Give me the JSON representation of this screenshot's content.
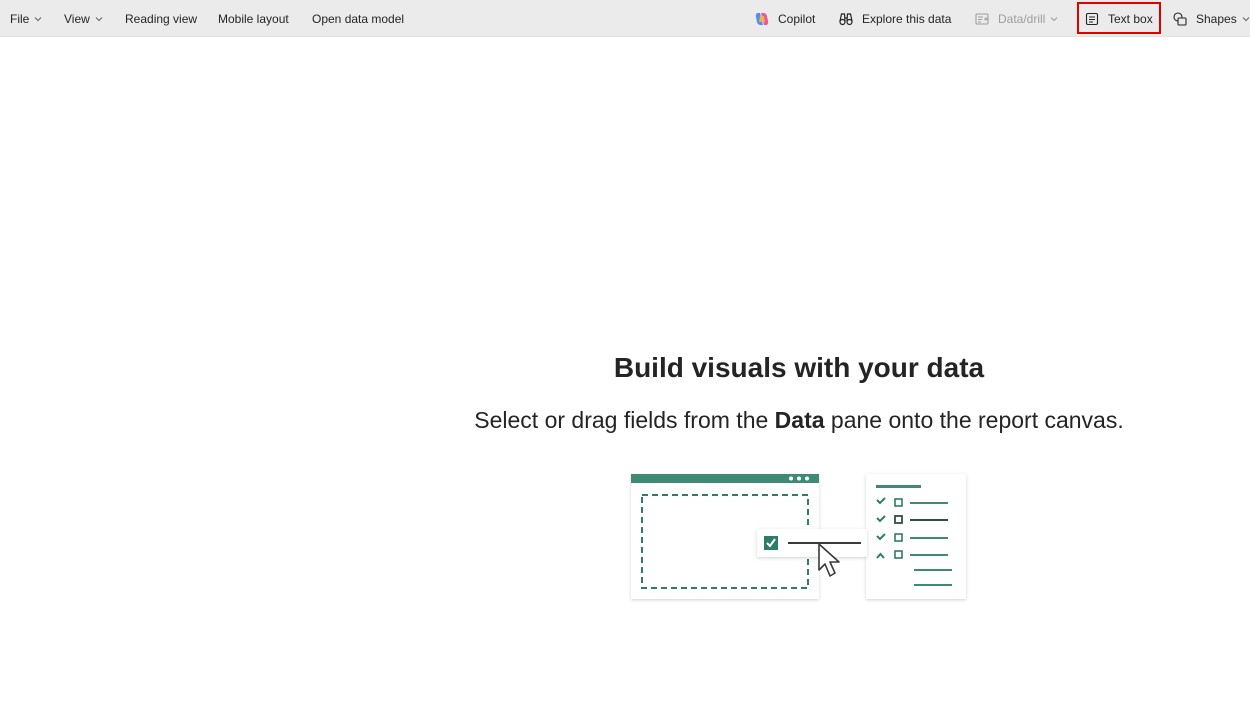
{
  "toolbar": {
    "file": "File",
    "view": "View",
    "reading_view": "Reading view",
    "mobile_layout": "Mobile layout",
    "open_data_model": "Open data model",
    "copilot": "Copilot",
    "explore": "Explore this data",
    "data_drill": "Data/drill",
    "text_box": "Text box",
    "shapes": "Shapes"
  },
  "canvas": {
    "headline": "Build visuals with your data",
    "sub_before": "Select or drag fields from the ",
    "sub_bold": "Data",
    "sub_after": " pane onto the report canvas."
  },
  "colors": {
    "toolbar_bg": "#ebebeb",
    "accent_green": "#2f7d68",
    "highlight": "#e00000"
  },
  "icons": [
    "chevron-down-icon",
    "copilot-icon",
    "binoculars-icon",
    "data-drill-icon",
    "text-box-icon",
    "shapes-icon"
  ]
}
